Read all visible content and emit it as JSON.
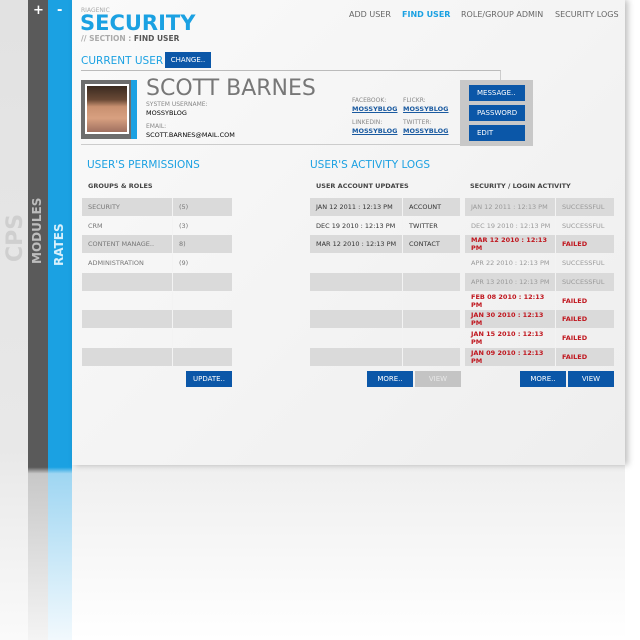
{
  "sidebar": {
    "cps": "CPS",
    "modules": "MODULES",
    "rates": "RATES",
    "plus": "+",
    "minus": "-"
  },
  "header": {
    "brand": "RIAGENIC",
    "title": "SECURITY",
    "section_prefix": "// SECTION :",
    "section": "FIND USER"
  },
  "nav": [
    {
      "label": "ADD USER"
    },
    {
      "label": "FIND USER",
      "active": true
    },
    {
      "label": "ROLE/GROUP ADMIN"
    },
    {
      "label": "SECURITY LOGS"
    }
  ],
  "current_user": {
    "heading": "CURRENT USER",
    "change": "CHANGE..",
    "name": "SCOTT BARNES",
    "username_label": "SYSTEM USERNAME:",
    "username": "MOSSYBLOG",
    "email_label": "EMAIL:",
    "email": "SCOTT.BARNES@MAIL.COM",
    "social": [
      {
        "label": "FACEBOOK:",
        "value": "MOSSYBLOG"
      },
      {
        "label": "FLICKR:",
        "value": "MOSSYBLOG"
      },
      {
        "label": "LINKEDIN:",
        "value": "MOSSYBLOG"
      },
      {
        "label": "TWITTER:",
        "value": "MOSSYBLOG"
      }
    ],
    "actions": [
      "MESSAGE..",
      "PASSWORD",
      "EDIT"
    ]
  },
  "permissions": {
    "heading": "USER'S PERMISSIONS",
    "subheading": "GROUPS & ROLES",
    "rows": [
      [
        "SECURITY",
        "(5)"
      ],
      [
        "CRM",
        "(3)"
      ],
      [
        "CONTENT MANAGE..",
        "8)"
      ],
      [
        "ADMINISTRATION",
        "(9)"
      ],
      [
        "",
        ""
      ],
      [
        "",
        ""
      ],
      [
        "",
        ""
      ],
      [
        "",
        ""
      ],
      [
        "",
        ""
      ]
    ],
    "update": "UPDATE.."
  },
  "activity": {
    "heading": "USER'S ACTIVITY LOGS",
    "updates": {
      "subheading": "USER ACCOUNT UPDATES",
      "rows": [
        [
          "JAN 12 2011 : 12:13 PM",
          "ACCOUNT"
        ],
        [
          "DEC 19 2010 : 12:13 PM",
          "TWITTER"
        ],
        [
          "MAR 12 2010 : 12:13 PM",
          "CONTACT"
        ],
        [
          "",
          ""
        ],
        [
          "",
          ""
        ],
        [
          "",
          ""
        ],
        [
          "",
          ""
        ],
        [
          "",
          ""
        ],
        [
          "",
          ""
        ]
      ],
      "more": "MORE..",
      "view": "VIEW"
    },
    "login": {
      "subheading": "SECURITY / LOGIN ACTIVITY",
      "rows": [
        [
          "JAN 12 2011 : 12:13 PM",
          "SUCCESSFUL"
        ],
        [
          "DEC 19 2010 : 12:13 PM",
          "SUCCESSFUL"
        ],
        [
          "MAR 12 2010 : 12:13 PM",
          "FAILED"
        ],
        [
          "APR 22 2010 : 12:13 PM",
          "SUCCESSFUL"
        ],
        [
          "APR 13 2010 : 12:13 PM",
          "SUCCESSFUL"
        ],
        [
          "FEB 08 2010 : 12:13 PM",
          "FAILED"
        ],
        [
          "JAN 30 2010 : 12:13 PM",
          "FAILED"
        ],
        [
          "JAN 15 2010 : 12:13 PM",
          "FAILED"
        ],
        [
          "JAN 09 2010 : 12:13 PM",
          "FAILED"
        ]
      ],
      "more": "MORE..",
      "view": "VIEW"
    }
  },
  "colors": {
    "accent": "#1ba1e2",
    "button": "#0b57a8",
    "failed": "#c0161e"
  }
}
